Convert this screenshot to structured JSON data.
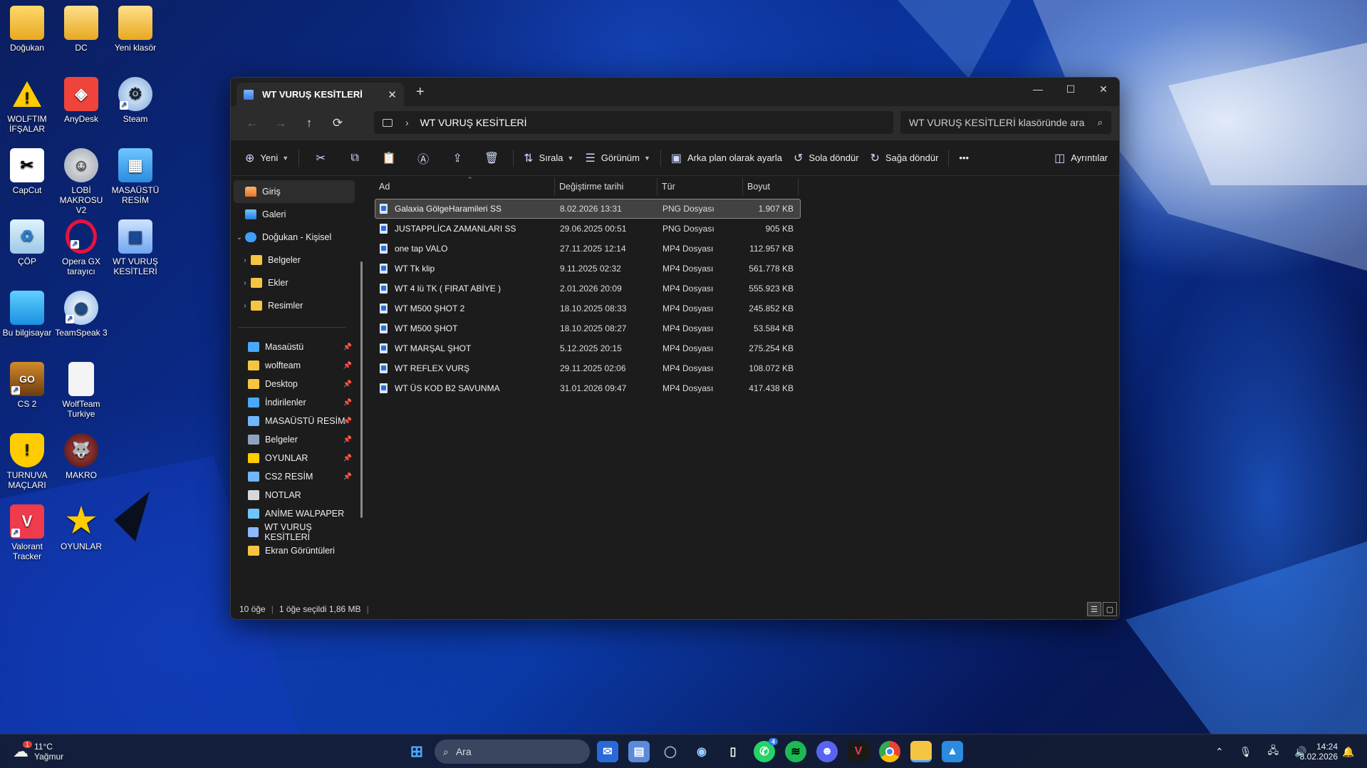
{
  "desktop": {
    "icons": [
      {
        "label": "Doğukan",
        "glyph": "folder"
      },
      {
        "label": "DC",
        "glyph": "folder"
      },
      {
        "label": "Yeni klasör",
        "glyph": "folder"
      },
      {
        "label": "WOLFTIM İFŞALAR",
        "glyph": "warning"
      },
      {
        "label": "AnyDesk",
        "glyph": "anydesk"
      },
      {
        "label": "Steam",
        "glyph": "steam"
      },
      {
        "label": "CapCut",
        "glyph": "capcut"
      },
      {
        "label": "LOBİ MAKROSU V2",
        "glyph": "robot"
      },
      {
        "label": "MASAÜSTÜ RESİM",
        "glyph": "image"
      },
      {
        "label": "ÇÖP",
        "glyph": "recycle"
      },
      {
        "label": "Opera GX tarayıcı",
        "glyph": "opera"
      },
      {
        "label": "WT VURUŞ KESİTLERİ",
        "glyph": "film"
      },
      {
        "label": "Bu bilgisayar",
        "glyph": "monitor"
      },
      {
        "label": "TeamSpeak 3",
        "glyph": "teamspeak"
      },
      {
        "label": "CS 2",
        "glyph": "cs2"
      },
      {
        "label": "WolfTeam Turkiye",
        "glyph": "file"
      },
      {
        "label": "TURNUVA MAÇLARI",
        "glyph": "shield"
      },
      {
        "label": "MAKRO",
        "glyph": "wolf"
      },
      {
        "label": "Valorant Tracker",
        "glyph": "valorant"
      },
      {
        "label": "OYUNLAR",
        "glyph": "star"
      }
    ]
  },
  "window": {
    "tab_title": "WT VURUŞ KESİTLERİ",
    "new_tab": "+",
    "controls": {
      "minimize": "—",
      "maximize": "☐",
      "close": "✕"
    }
  },
  "nav": {
    "back": "←",
    "forward": "→",
    "up": "↑",
    "refresh": "⟳",
    "path_separator": "›",
    "path": "WT VURUŞ KESİTLERİ",
    "search_placeholder": "WT VURUŞ KESİTLERİ klasöründe ara"
  },
  "toolbar": {
    "new_label": "Yeni",
    "sort_label": "Sırala",
    "view_label": "Görünüm",
    "set_background_label": "Arka plan olarak ayarla",
    "rotate_left_label": "Sola döndür",
    "rotate_right_label": "Sağa döndür",
    "more_label": "•••",
    "details_label": "Ayrıntılar"
  },
  "sidebar": {
    "items": [
      {
        "label": "Giriş",
        "icon": "home-icon"
      },
      {
        "label": "Galeri",
        "icon": "gallery-icon"
      },
      {
        "label": "Doğukan - Kişisel",
        "icon": "cloud-icon"
      },
      {
        "label": "Belgeler",
        "icon": "folder-icon"
      },
      {
        "label": "Ekler",
        "icon": "folder-icon"
      },
      {
        "label": "Resimler",
        "icon": "folder-icon"
      }
    ],
    "pinned": [
      {
        "label": "Masaüstü"
      },
      {
        "label": "wolfteam"
      },
      {
        "label": "Desktop"
      },
      {
        "label": "İndirilenler"
      },
      {
        "label": "MASAÜSTÜ RESİM"
      },
      {
        "label": "Belgeler"
      },
      {
        "label": "OYUNLAR"
      },
      {
        "label": "CS2 RESİM"
      },
      {
        "label": "NOTLAR"
      },
      {
        "label": "ANİME WALPAPER"
      },
      {
        "label": "WT VURUŞ KESİTLERİ"
      },
      {
        "label": "Ekran Görüntüleri"
      }
    ]
  },
  "columns": {
    "name": "Ad",
    "modified": "Değiştirme tarihi",
    "type": "Tür",
    "size": "Boyut"
  },
  "files": [
    {
      "name": "Galaxia GölgeHaramileri SS",
      "modified": "8.02.2026 13:31",
      "type": "PNG Dosyası",
      "size": "1.907 KB",
      "selected": true
    },
    {
      "name": "JUSTAPPLİCA ZAMANLARI SS",
      "modified": "29.06.2025 00:51",
      "type": "PNG Dosyası",
      "size": "905 KB"
    },
    {
      "name": "one tap VALO",
      "modified": "27.11.2025 12:14",
      "type": "MP4 Dosyası",
      "size": "112.957 KB"
    },
    {
      "name": "WT  Tk klip",
      "modified": "9.11.2025 02:32",
      "type": "MP4 Dosyası",
      "size": "561.778 KB"
    },
    {
      "name": "WT 4 lü TK ( FIRAT ABİYE )",
      "modified": "2.01.2026 20:09",
      "type": "MP4 Dosyası",
      "size": "555.923 KB"
    },
    {
      "name": "WT M500 ŞHOT 2",
      "modified": "18.10.2025 08:33",
      "type": "MP4 Dosyası",
      "size": "245.852 KB"
    },
    {
      "name": "WT M500 ŞHOT",
      "modified": "18.10.2025 08:27",
      "type": "MP4 Dosyası",
      "size": "53.584 KB"
    },
    {
      "name": "WT MARŞAL ŞHOT",
      "modified": "5.12.2025 20:15",
      "type": "MP4 Dosyası",
      "size": "275.254 KB"
    },
    {
      "name": "WT REFLEX VURŞ",
      "modified": "29.11.2025 02:06",
      "type": "MP4 Dosyası",
      "size": "108.072 KB"
    },
    {
      "name": "WT ÜS KOD B2 SAVUNMA",
      "modified": "31.01.2026 09:47",
      "type": "MP4 Dosyası",
      "size": "417.438 KB"
    }
  ],
  "status": {
    "count": "10 öğe",
    "selection": "1 öğe seçildi  1,86 MB"
  },
  "taskbar": {
    "weather_temp": "11°C",
    "weather_desc": "Yağmur",
    "weather_badge": "1",
    "search_label": "Ara",
    "whatsapp_badge": "4",
    "time": "14:24",
    "date": "8.02.2026",
    "colors": {
      "accent": "#2f7bf5"
    }
  }
}
